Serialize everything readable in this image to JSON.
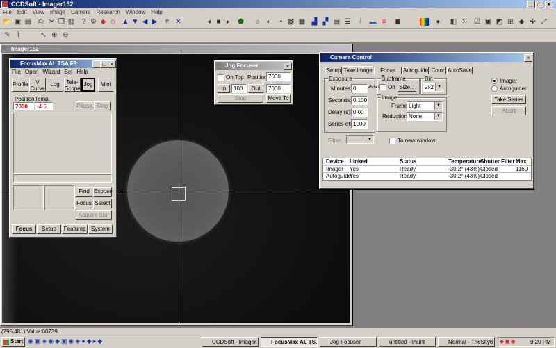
{
  "app": {
    "title": "CCDSoft - Imager152",
    "menu": [
      "File",
      "Edit",
      "View",
      "Image",
      "Camera",
      "Research",
      "Window",
      "Help"
    ]
  },
  "image_window": {
    "title": "Imager152"
  },
  "status_bar": {
    "readout": "(795,481) Value:00739"
  },
  "focusmax": {
    "title": "FocusMax  AL TSA F8",
    "menu": [
      "File",
      "Open",
      "Wizard",
      "Set",
      "Help"
    ],
    "top_buttons": [
      "Profile",
      "V Curve",
      "Log",
      "Tele-Scope",
      "Jog",
      "Mini"
    ],
    "position_label": "Position",
    "temp_label": "Temp.",
    "position_value": "7000",
    "temp_value": "-4.5",
    "pause_label": "Pause",
    "stop_label": "Stop",
    "find_label": "Find",
    "expose_label": "Expose",
    "focus_label": "Focus",
    "select_label": "Select",
    "acquire_label": "Acquire Star",
    "tabs": [
      "Focus",
      "Setup",
      "Features",
      "System"
    ]
  },
  "jog": {
    "title": "Jog Focuser",
    "ontop_label": "On Top",
    "position_label": "Position",
    "position_value": "7000",
    "in_label": "In",
    "step_value": "100",
    "out_label": "Out",
    "target_value": "7000",
    "stop_label": "Stop",
    "moveto_label": "Move To"
  },
  "camera": {
    "title": "Camera Control",
    "tabs": [
      "Setup",
      "Take Image",
      "Focus Tools",
      "Autoguide",
      "Color",
      "AutoSave"
    ],
    "exposure_group": "Exposure",
    "minutes_label": "Minutes:",
    "minutes_value": "0",
    "seconds_label": "Seconds:",
    "seconds_value": "0.100",
    "delay_label": "Delay (s):",
    "delay_value": "0.00",
    "series_label": "Series of:",
    "series_value": "1000",
    "subframe_group": "Subframe",
    "subframe_on_label": "On",
    "size_label": "Size...",
    "bin_group": "Bin",
    "bin_value": "2x2",
    "image_group": "Image",
    "frame_label": "Frame:",
    "frame_value": "Light",
    "reduction_label": "Reduction:",
    "reduction_value": "None",
    "filter_label": "Filter:",
    "new_window_label": "To new window",
    "imager_label": "Imager",
    "autoguider_label": "Autoguider",
    "take_series_label": "Take Series",
    "abort_label": "Abort",
    "table_headers": [
      "Device",
      "Linked",
      "Status",
      "Temperature",
      "Shutter",
      "Filter",
      "Max"
    ],
    "table_rows": [
      [
        "Imager",
        "Yes",
        "Ready",
        "-30.2° (43%)",
        "Closed",
        "",
        "1160"
      ],
      [
        "Autoguider",
        "Yes",
        "Ready",
        "-30.2° (43%)",
        "Closed",
        "",
        ""
      ]
    ]
  },
  "taskbar": {
    "start_label": "Start",
    "tasks": [
      "CCDSoft - Imager...",
      "FocusMax  AL TS...",
      "Jog Focuser",
      "untitled - Paint",
      "Normal - TheSky6"
    ],
    "clock": "9:20 PM"
  },
  "colors": {
    "title_active": "#0a246a",
    "title_gradient_end": "#a6caf0",
    "chrome": "#d4d0c8",
    "star_image_bg": "#111111",
    "position_red": "#c00000"
  },
  "icons": [
    "open-icon",
    "save-icon",
    "print-icon",
    "cut-icon",
    "copy-icon",
    "paste-icon",
    "help-icon",
    "arrow-up-icon",
    "arrow-down-icon",
    "arrow-left-icon",
    "arrow-right-icon",
    "play-icon",
    "stop-icon",
    "histogram-icon",
    "color-icon",
    "pointer-icon",
    "zoom-in-icon",
    "zoom-out-icon"
  ]
}
